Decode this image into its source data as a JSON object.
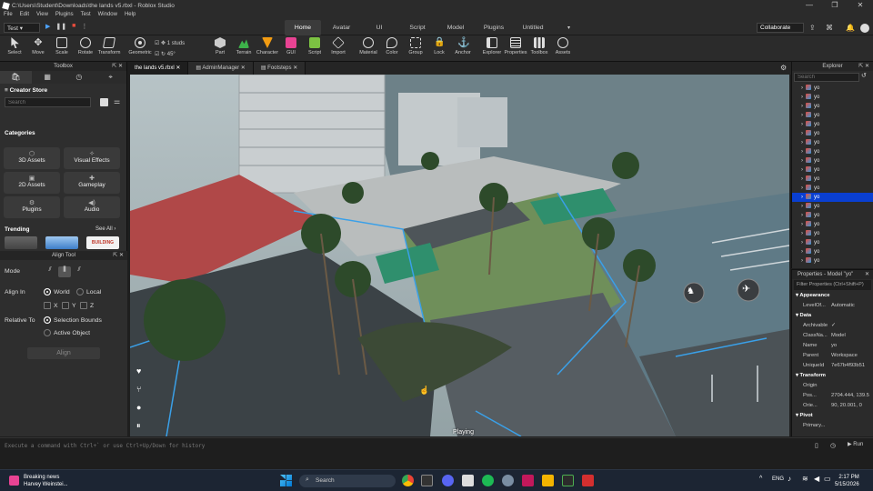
{
  "window": {
    "title": "C:\\Users\\Student\\Downloads\\the lands v5.rbxl - Roblox Studio",
    "min": "—",
    "max": "❐",
    "close": "✕"
  },
  "menu": [
    "File",
    "Edit",
    "View",
    "Plugins",
    "Test",
    "Window",
    "Help"
  ],
  "ribbonTabs": [
    "Home",
    "Avatar",
    "UI",
    "Script",
    "Model",
    "Plugins",
    "Untitled"
  ],
  "testMode": "Test",
  "collaborate": "Collaborate",
  "tools": [
    "Select",
    "Move",
    "Scale",
    "Rotate",
    "Transform",
    "Geometric",
    "Part",
    "Terrain",
    "Character",
    "GUI",
    "Script",
    "Import",
    "Material",
    "Color",
    "Group",
    "Lock",
    "Anchor",
    "Explorer",
    "Properties",
    "Toolbox",
    "Assets"
  ],
  "snap": {
    "move": "1 studs",
    "rotate": "45°"
  },
  "toolbox": {
    "title": "Toolbox",
    "store": "Creator Store",
    "search_placeholder": "Search",
    "categories_title": "Categories",
    "categories": [
      "3D Assets",
      "Visual Effects",
      "2D Assets",
      "Gameplay",
      "Plugins",
      "Audio"
    ],
    "trending": "Trending",
    "see_all": "See All",
    "thumb3": "BUILDING"
  },
  "align": {
    "title": "Align Tool",
    "mode": "Mode",
    "align_in": "Align In",
    "world": "World",
    "local": "Local",
    "x": "X",
    "y": "Y",
    "z": "Z",
    "relative_to": "Relative To",
    "selection_bounds": "Selection Bounds",
    "active_object": "Active Object",
    "align_btn": "Align"
  },
  "docTabs": [
    "the lands v5.rbxl",
    "AdminManager",
    "Footsteps"
  ],
  "viewport": {
    "status": "Playing"
  },
  "explorer": {
    "title": "Explorer",
    "search": "Search",
    "item": "yo",
    "count": 20,
    "selected_index": 12
  },
  "properties": {
    "title": "Properties - Model \"yo\"",
    "filter": "Filter Properties (Ctrl+Shift+P)",
    "rows": [
      {
        "sec": "Appearance"
      },
      {
        "k": "LevelOf...",
        "v": "Automatic"
      },
      {
        "sec": "Data"
      },
      {
        "k": "Archivable",
        "v": "✓"
      },
      {
        "k": "ClassNa...",
        "v": "Model"
      },
      {
        "k": "Name",
        "v": "yo"
      },
      {
        "k": "Parent",
        "v": "Workspace"
      },
      {
        "k": "UniqueId",
        "v": "7e67b4f93b51"
      },
      {
        "sec": "Transform"
      },
      {
        "k": "Origin",
        "v": ""
      },
      {
        "k": "Pos...",
        "v": "2704.444, 139.5"
      },
      {
        "k": "Orie...",
        "v": "90, 20.001, 0"
      },
      {
        "sec": "Pivot"
      },
      {
        "k": "Primary...",
        "v": ""
      }
    ]
  },
  "command": {
    "placeholder": "Execute a command with Ctrl+` or use Ctrl+Up/Down for history",
    "run": "Run"
  },
  "taskbar": {
    "news_title": "Breaking news",
    "news_sub": "Harvey Weinstei...",
    "search": "Search",
    "lang": "ENG",
    "time": "2:17 PM",
    "date": "5/15/2026"
  }
}
